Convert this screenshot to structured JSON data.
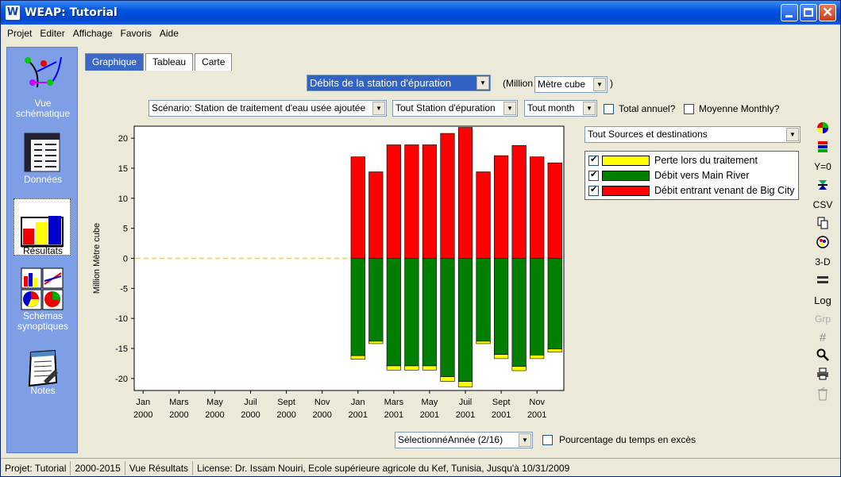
{
  "window": {
    "title": "WEAP: Tutorial",
    "app_icon_letter": "W"
  },
  "menu": [
    "Projet",
    "Editer",
    "Affichage",
    "Favoris",
    "Aide"
  ],
  "sidebar": {
    "items": [
      {
        "label": "Vue\nschématique"
      },
      {
        "label": "Données"
      },
      {
        "label": "Résultats"
      },
      {
        "label": "Schémas\nsynoptiques"
      },
      {
        "label": "Notes"
      }
    ]
  },
  "tabs": [
    {
      "label": "Graphique",
      "active": true
    },
    {
      "label": "Tableau",
      "active": false
    },
    {
      "label": "Carte",
      "active": false
    }
  ],
  "controls": {
    "variable": "Débits de la station d'épuration",
    "unit_prefix": "(Million",
    "unit": "Mètre cube",
    "unit_suffix": ")",
    "scenario": "Scénario: Station de traitement d'eau usée ajoutée",
    "station": "Tout Station d'épuration",
    "month": "Tout month",
    "total_annual": "Total annuel?",
    "monthly_avg": "Moyenne Monthly?",
    "sources": "Tout Sources et destinations",
    "year_select": "SélectionnéAnnée (2/16)",
    "exceedance": "Pourcentage du temps en excès"
  },
  "colors": {
    "red": "#ff0000",
    "green": "#007f00",
    "yellow": "#ffff00",
    "sidebar": "#7e9fe6",
    "tab_active": "#3b68c4"
  },
  "tools": [
    "color-wheel-icon",
    "palette-icon",
    "Y=0",
    "stack-icon",
    "CSV",
    "copy-icon",
    "chart-type-icon",
    "3-D",
    "line-icon",
    "Log",
    "Grp",
    "grid-icon",
    "zoom-icon",
    "print-icon",
    "trash-icon"
  ],
  "chart_data": {
    "type": "bar",
    "ylabel": "Million Mètre cube",
    "ylim": [
      -22,
      22
    ],
    "yticks": [
      20,
      15,
      10,
      5,
      0,
      -5,
      -10,
      -15,
      -20
    ],
    "x_tick_labels": [
      [
        "Jan",
        "2000"
      ],
      [
        "Mars",
        "2000"
      ],
      [
        "May",
        "2000"
      ],
      [
        "Juil",
        "2000"
      ],
      [
        "Sept",
        "2000"
      ],
      [
        "Nov",
        "2000"
      ],
      [
        "Jan",
        "2001"
      ],
      [
        "Mars",
        "2001"
      ],
      [
        "May",
        "2001"
      ],
      [
        "Juil",
        "2001"
      ],
      [
        "Sept",
        "2001"
      ],
      [
        "Nov",
        "2001"
      ]
    ],
    "months": 24,
    "series": [
      {
        "name": "Perte lors du traitement",
        "color": "#ffff00",
        "values": [
          0,
          0,
          0,
          0,
          0,
          0,
          0,
          0,
          0,
          0,
          0,
          0,
          -0.6,
          -0.4,
          -0.7,
          -0.7,
          -0.7,
          -0.8,
          -0.9,
          -0.4,
          -0.7,
          -0.7,
          -0.6,
          -0.5
        ]
      },
      {
        "name": "Débit vers Main River",
        "color": "#007f00",
        "values": [
          0,
          0,
          0,
          0,
          0,
          0,
          0,
          0,
          0,
          0,
          0,
          0,
          -16.2,
          -13.8,
          -17.9,
          -17.9,
          -17.9,
          -19.7,
          -20.5,
          -13.8,
          -16.0,
          -18.0,
          -16.1,
          -15.1
        ]
      },
      {
        "name": "Débit entrant venant de Big City",
        "color": "#ff0000",
        "values": [
          0,
          0,
          0,
          0,
          0,
          0,
          0,
          0,
          0,
          0,
          0,
          0,
          16.9,
          14.4,
          18.9,
          18.9,
          18.9,
          20.8,
          21.8,
          14.4,
          17.1,
          18.8,
          16.9,
          15.9
        ]
      }
    ]
  },
  "status": {
    "project": "Projet: Tutorial",
    "years": "2000-2015",
    "view": "Vue Résultats",
    "license": "License: Dr. Issam Nouiri, Ecole supérieure agricole du Kef, Tunisia, Jusqu'à 10/31/2009"
  }
}
